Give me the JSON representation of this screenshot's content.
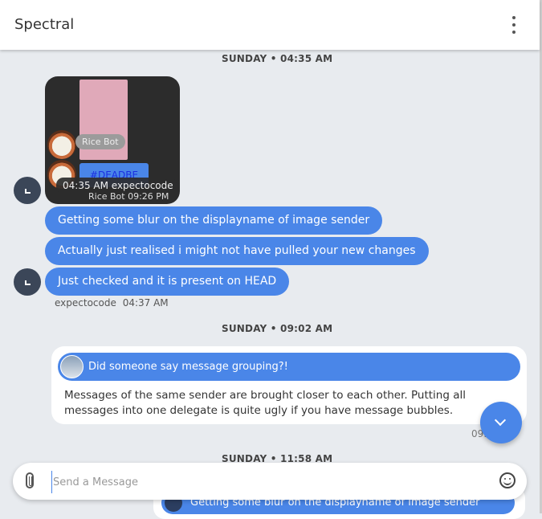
{
  "app": {
    "title": "Spectral"
  },
  "dates": {
    "first": "SUNDAY • 04:35 AM",
    "second": "SUNDAY • 09:02 AM",
    "third": "SUNDAY • 11:58 AM"
  },
  "image_message": {
    "sender_pill": "Rice Bot",
    "code_text": "#DEADBE",
    "overlay_time_sender": "04:35 AM  expectocode",
    "sub_sender_time": "Rice Bot  09:26 PM"
  },
  "messages": [
    {
      "text": "Getting some blur on the displayname of image sender"
    },
    {
      "text": "Actually just realised i might not have pulled your new changes"
    },
    {
      "text": "Just checked and it is present on HEAD"
    }
  ],
  "group_meta": {
    "sender": "expectocode",
    "time": "04:37 AM"
  },
  "reply": {
    "quoted_text": "Did someone say message grouping?!",
    "body": "Messages of the same sender are brought closer to each other. Putting all messages into one delegate is quite ugly if you have message bubbles.",
    "time_partial": "09:"
  },
  "peek_text": "Getting some blur on the displayname of image sender",
  "composer": {
    "placeholder": "Send a Message",
    "value": ""
  },
  "colors": {
    "accent": "#4a86e8",
    "avatar": "#3b4658",
    "background": "#e8ebef"
  }
}
